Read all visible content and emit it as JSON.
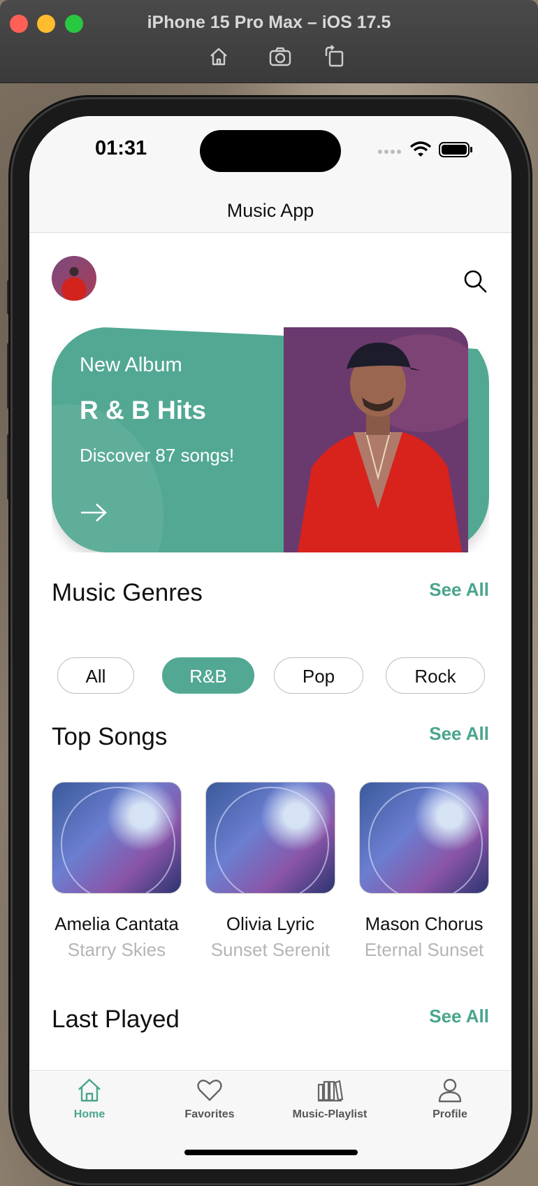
{
  "simulator": {
    "title": "iPhone 15 Pro Max – iOS 17.5",
    "tools": [
      "home-icon",
      "screenshot-icon",
      "rotate-icon"
    ]
  },
  "status_bar": {
    "time": "01:31"
  },
  "navbar": {
    "title": "Music App"
  },
  "banner": {
    "kicker": "New Album",
    "title": "R & B Hits",
    "subtitle": "Discover 87 songs!"
  },
  "genres": {
    "title": "Music Genres",
    "see_all": "See All",
    "chips": [
      {
        "label": "All",
        "active": false
      },
      {
        "label": "R&B",
        "active": true
      },
      {
        "label": "Pop",
        "active": false
      },
      {
        "label": "Rock",
        "active": false
      }
    ]
  },
  "top_songs": {
    "title": "Top Songs",
    "see_all": "See All",
    "items": [
      {
        "name": "Amelia Cantata",
        "artist": "Starry Skies"
      },
      {
        "name": "Olivia Lyric",
        "artist": "Sunset Serenit"
      },
      {
        "name": "Mason Chorus",
        "artist": "Eternal Sunset"
      }
    ]
  },
  "last_played": {
    "title": "Last Played",
    "see_all": "See All"
  },
  "tabbar": {
    "items": [
      {
        "label": "Home",
        "icon": "home-icon",
        "active": true
      },
      {
        "label": "Favorites",
        "icon": "heart-icon",
        "active": false
      },
      {
        "label": "Music-Playlist",
        "icon": "library-icon",
        "active": false
      },
      {
        "label": "Profile",
        "icon": "person-icon",
        "active": false
      }
    ]
  },
  "colors": {
    "accent": "#52a893",
    "accent_text": "#4aa58d",
    "muted": "#b5b5b5"
  }
}
